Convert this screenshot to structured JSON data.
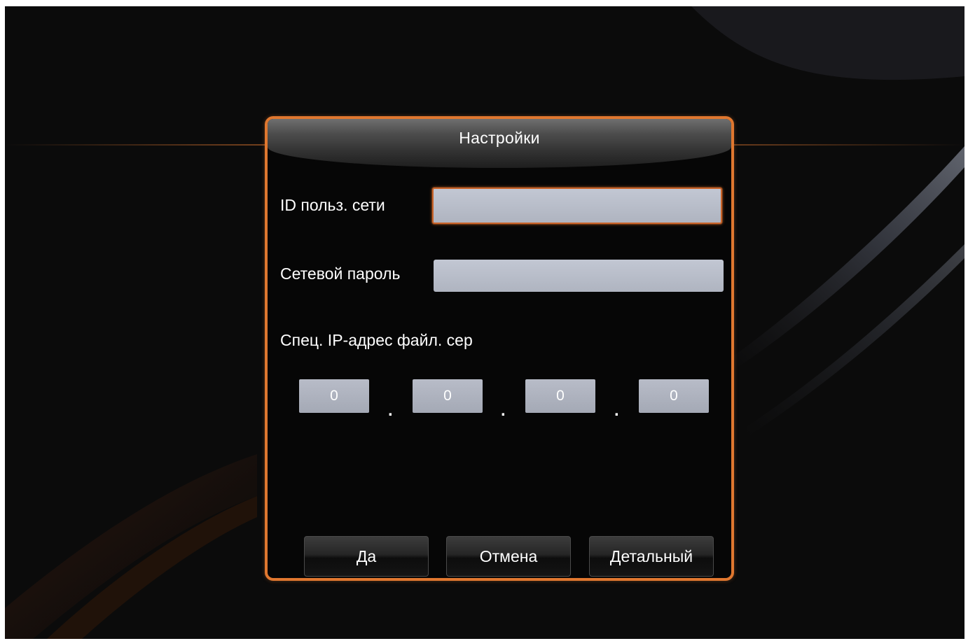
{
  "dialog": {
    "title": "Настройки",
    "fields": {
      "user_id_label": "ID польз. сети",
      "user_id_value": "",
      "password_label": "Сетевой пароль",
      "password_value": "",
      "ip_label": "Спец. IP-адрес файл. сер",
      "ip_octets": [
        "0",
        "0",
        "0",
        "0"
      ],
      "ip_separator": "."
    },
    "buttons": {
      "ok": "Да",
      "cancel": "Отмена",
      "advanced": "Детальный"
    }
  },
  "colors": {
    "accent": "#e0772f",
    "background": "#0b0b0b",
    "input_fill": "#b6bbc7"
  }
}
